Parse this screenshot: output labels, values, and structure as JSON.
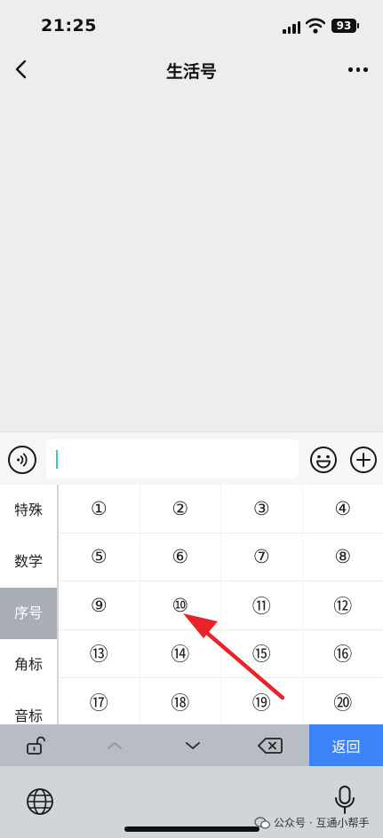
{
  "status_bar": {
    "time": "21:25",
    "battery": "93"
  },
  "nav": {
    "title": "生活号"
  },
  "keyboard": {
    "categories": [
      "特殊",
      "数学",
      "序号",
      "角标",
      "音标"
    ],
    "active_category": "序号",
    "symbols": [
      [
        "①",
        "②",
        "③",
        "④"
      ],
      [
        "⑤",
        "⑥",
        "⑦",
        "⑧"
      ],
      [
        "⑨",
        "⑩",
        "⑪",
        "⑫"
      ],
      [
        "⑬",
        "⑭",
        "⑮",
        "⑯"
      ],
      [
        "⑰",
        "⑱",
        "⑲",
        "⑳"
      ]
    ],
    "return_label": "返回"
  },
  "watermark": "公众号 · 互通小帮手",
  "colors": {
    "accent": "#3d82f6",
    "annotation_arrow": "#e8232b",
    "caret": "#2ed3b0"
  }
}
